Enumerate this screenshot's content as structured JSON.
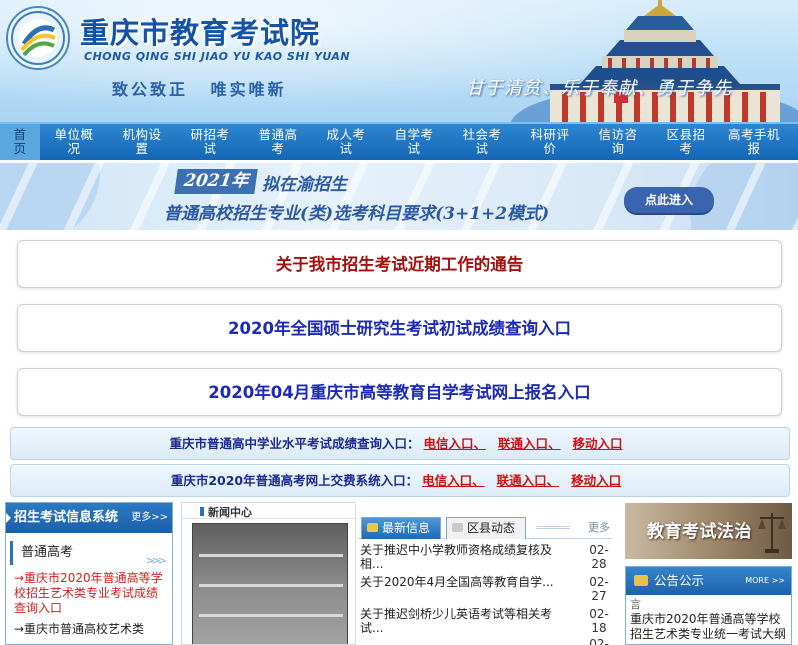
{
  "header": {
    "title": "重庆市教育考试院",
    "pinyin": "CHONG QING SHI JIAO YU KAO SHI YUAN",
    "motto": "致公致正  唯实唯新",
    "slogan": "甘于清贫、乐于奉献、勇于争先",
    "logo_icon": "seal-logo-icon"
  },
  "nav": {
    "items": [
      {
        "line1": "首",
        "line2": "页"
      },
      {
        "line1": "单位概",
        "line2": "况"
      },
      {
        "line1": "机构设",
        "line2": "置"
      },
      {
        "line1": "研招考",
        "line2": "试"
      },
      {
        "line1": "普通高",
        "line2": "考"
      },
      {
        "line1": "成人考",
        "line2": "试"
      },
      {
        "line1": "自学考",
        "line2": "试"
      },
      {
        "line1": "社会考",
        "line2": "试"
      },
      {
        "line1": "科研评",
        "line2": "价"
      },
      {
        "line1": "信访咨",
        "line2": "询"
      },
      {
        "line1": "区县招",
        "line2": "考"
      },
      {
        "line1": "高考手机",
        "line2": "报"
      }
    ]
  },
  "banner": {
    "year": "2021年",
    "line1": "拟在渝招生",
    "line2": "普通高校招生专业(类)选考科目要求(3+1+2模式)",
    "button": "点此进入"
  },
  "notices": [
    "关于我市招生考试近期工作的通告",
    "2020年全国硕士研究生考试初试成绩查询入口",
    "2020年04月重庆市高等教育自学考试网上报名入口"
  ],
  "queries": [
    {
      "label": "重庆市普通高中学业水平考试成绩查询入口：",
      "links": [
        "电信入口、",
        "联通入口、",
        "移动入口"
      ]
    },
    {
      "label": "重庆市2020年普通高考网上交费系统入口：",
      "links": [
        "电信入口、",
        "联通入口、",
        "移动入口"
      ]
    }
  ],
  "left_panel": {
    "title": "招生考试信息系统",
    "more": "更多>>",
    "sub": "普通高考",
    "links": [
      "→重庆市2020年普通高等学校招生艺术类专业考试成绩查询入口",
      "→重庆市普通高校艺术类"
    ]
  },
  "photo_panel": {
    "title": "新闻中心"
  },
  "news_panel": {
    "tab_latest": "最新信息",
    "tab_district": "区县动态",
    "more": "更多",
    "items": [
      {
        "title": "关于推迟中小学教师资格成绩复核及相...",
        "date": "02-28"
      },
      {
        "title": "关于2020年4月全国高等教育自学...",
        "date": "02-27"
      },
      {
        "title": "关于推迟剑桥少儿英语考试等相关考试...",
        "date": "02-18"
      },
      {
        "title": "",
        "date": "02-"
      }
    ]
  },
  "law": {
    "title": "教育考试法治"
  },
  "announce": {
    "title": "公告公示",
    "more": "MORE >>",
    "lead": "言",
    "text": "重庆市2020年普通高等学校招生艺术类专业统一考试大纲"
  },
  "colors": {
    "nav_bg": "#1466b5",
    "notice_red": "#a3100f",
    "notice_blue": "#1c2bb6",
    "link_red": "#d01010"
  }
}
